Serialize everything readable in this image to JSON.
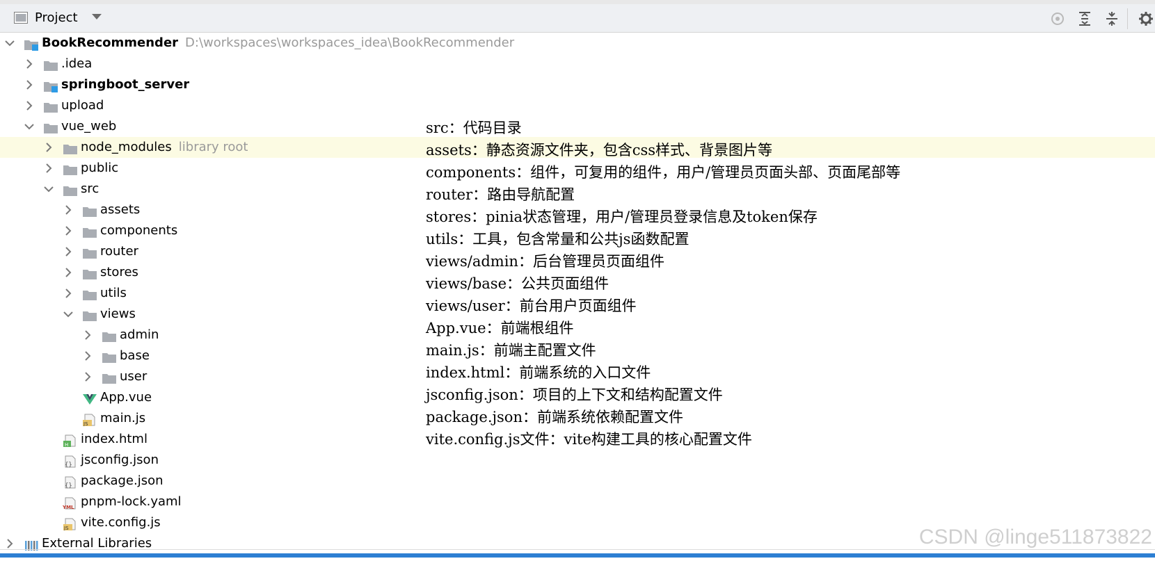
{
  "panel": {
    "title": "Project"
  },
  "tree": {
    "root": {
      "label": "BookRecommender",
      "path": "D:\\workspaces\\workspaces_idea\\BookRecommender"
    },
    "items": [
      {
        "label": ".idea"
      },
      {
        "label": "springboot_server"
      },
      {
        "label": "upload"
      },
      {
        "label": "vue_web"
      },
      {
        "label": "node_modules",
        "hint": "library root"
      },
      {
        "label": "public"
      },
      {
        "label": "src"
      },
      {
        "label": "assets"
      },
      {
        "label": "components"
      },
      {
        "label": "router"
      },
      {
        "label": "stores"
      },
      {
        "label": "utils"
      },
      {
        "label": "views"
      },
      {
        "label": "admin"
      },
      {
        "label": "base"
      },
      {
        "label": "user"
      },
      {
        "label": "App.vue"
      },
      {
        "label": "main.js"
      },
      {
        "label": "index.html"
      },
      {
        "label": "jsconfig.json"
      },
      {
        "label": "package.json"
      },
      {
        "label": "pnpm-lock.yaml"
      },
      {
        "label": "vite.config.js"
      },
      {
        "label": "External Libraries"
      }
    ]
  },
  "annotations": [
    "src：代码目录",
    "assets：静态资源文件夹，包含css样式、背景图片等",
    "components：组件，可复用的组件，用户/管理员页面头部、页面尾部等",
    "router：路由导航配置",
    "stores：pinia状态管理，用户/管理员登录信息及token保存",
    "utils：工具，包含常量和公共js函数配置",
    "views/admin：后台管理员页面组件",
    "views/base：公共页面组件",
    "views/user：前台用户页面组件",
    "App.vue：前端根组件",
    "main.js：前端主配置文件",
    "index.html：前端系统的入口文件",
    "jsconfig.json：项目的上下文和结构配置文件",
    "package.json：前端系统依赖配置文件",
    "vite.config.js文件：vite构建工具的核心配置文件"
  ],
  "watermark": "CSDN @linge511873822",
  "colors": {
    "folder": "#a9adb3",
    "selection": "#fcfbe3",
    "module": "#2e9be5",
    "bottom": "#2d7fd3"
  }
}
